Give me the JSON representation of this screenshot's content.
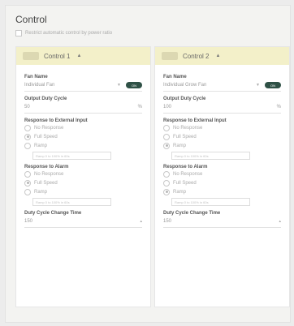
{
  "panel": {
    "title": "Control",
    "restrict_label": "Restrict automatic control by power ratio"
  },
  "controls": [
    {
      "name": "Control 1",
      "fan_name_label": "Fan Name",
      "fan_name_value": "Individual Fan",
      "fan_toggle": "ON",
      "output_duty_label": "Output Duty Cycle",
      "output_duty_value": "50",
      "unit_percent": "%",
      "response_external_label": "Response to External Input",
      "external_options": [
        "No Response",
        "Full Speed",
        "Ramp"
      ],
      "external_selected": "Full Speed",
      "external_ramp_placeholder": "Ramp 0 to 100% in 60s",
      "response_alarm_label": "Response to Alarm",
      "alarm_options": [
        "No Response",
        "Full Speed",
        "Ramp"
      ],
      "alarm_selected": "Full Speed",
      "alarm_ramp_placeholder": "Ramp 0 to 100% in 60s",
      "change_time_label": "Duty Cycle Change Time",
      "change_time_value": "150"
    },
    {
      "name": "Control 2",
      "fan_name_label": "Fan Name",
      "fan_name_value": "Individual Grow Fan",
      "fan_toggle": "ON",
      "output_duty_label": "Output Duty Cycle",
      "output_duty_value": "100",
      "unit_percent": "%",
      "response_external_label": "Response to External Input",
      "external_options": [
        "No Response",
        "Full Speed",
        "Ramp"
      ],
      "external_selected": "Ramp",
      "external_ramp_placeholder": "Ramp 0 to 100% in 60s",
      "response_alarm_label": "Response to Alarm",
      "alarm_options": [
        "No Response",
        "Full Speed",
        "Ramp"
      ],
      "alarm_selected": "Ramp",
      "alarm_ramp_placeholder": "Ramp 0 to 100% in 60s",
      "change_time_label": "Duty Cycle Change Time",
      "change_time_value": "150"
    }
  ]
}
